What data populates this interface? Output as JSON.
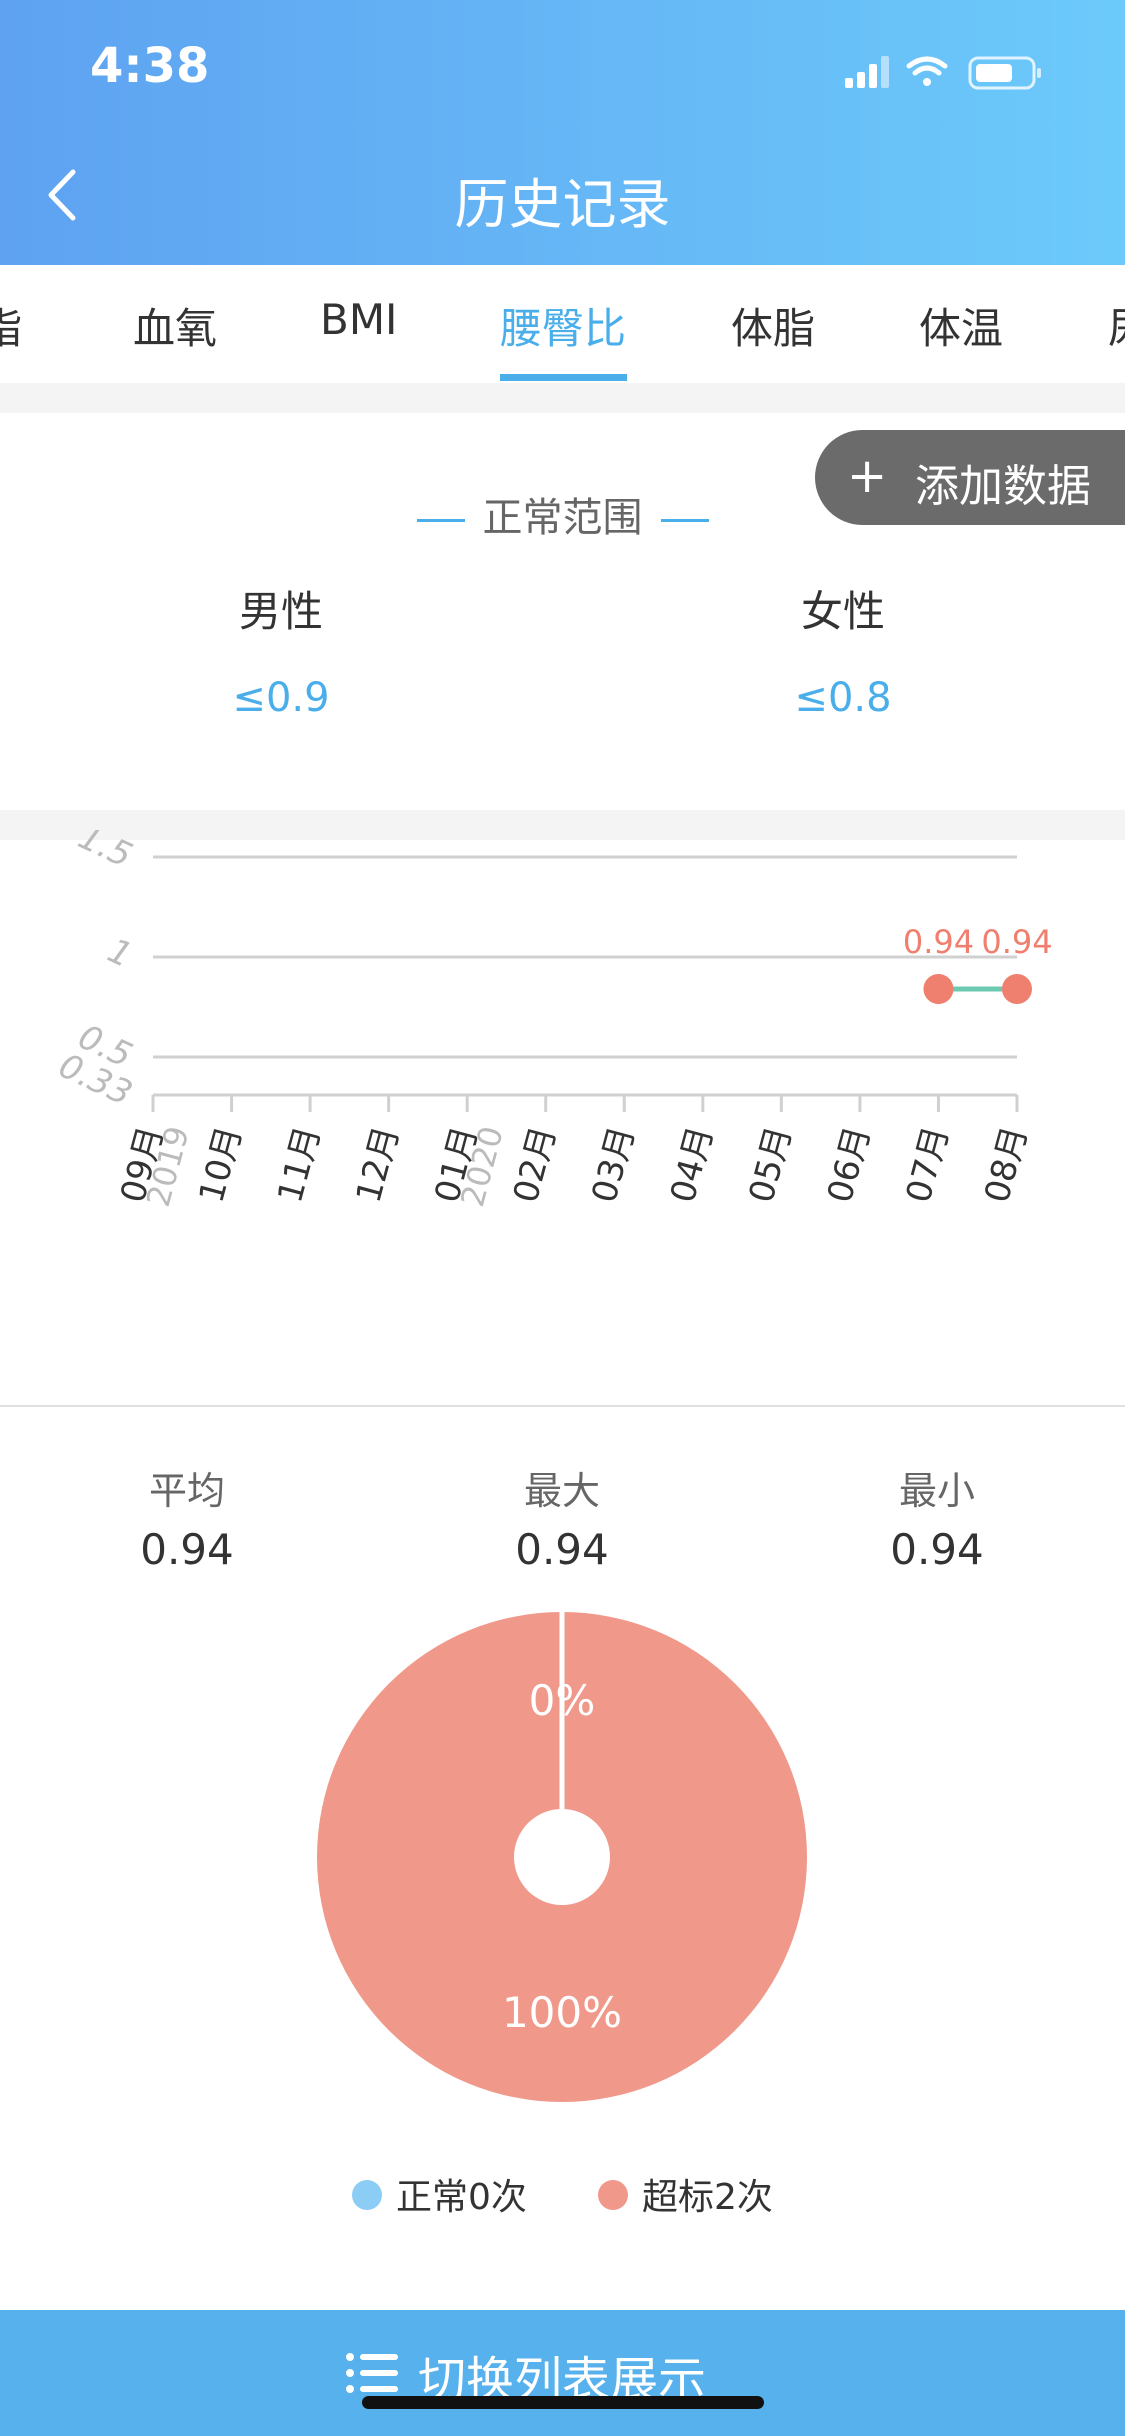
{
  "status": {
    "time": "4:38"
  },
  "header": {
    "title": "历史记录"
  },
  "tabs": [
    {
      "label": "脂"
    },
    {
      "label": "血氧"
    },
    {
      "label": "BMI"
    },
    {
      "label": "腰臀比",
      "active": true
    },
    {
      "label": "体脂"
    },
    {
      "label": "体温"
    },
    {
      "label": "尿"
    }
  ],
  "add_button": {
    "plus": "+",
    "label": "添加数据"
  },
  "normal_range": {
    "title": "正常范围",
    "male_label": "男性",
    "male_value": "≤0.9",
    "female_label": "女性",
    "female_value": "≤0.8"
  },
  "chart_data": {
    "type": "line",
    "y_ticks": [
      "1.5",
      "1",
      "0.5",
      "0.33"
    ],
    "ylim": [
      0.33,
      1.5
    ],
    "categories": [
      "09月",
      "10月",
      "11月",
      "12月",
      "01月",
      "02月",
      "03月",
      "04月",
      "05月",
      "06月",
      "07月",
      "08月"
    ],
    "year_labels": [
      {
        "after_index": 0,
        "text": "2019"
      },
      {
        "after_index": 4,
        "text": "2020"
      }
    ],
    "series": [
      {
        "points": [
          {
            "category": "07月",
            "value": 0.94
          },
          {
            "category": "08月",
            "value": 0.94
          }
        ]
      }
    ],
    "data_labels": [
      "0.94",
      "0.94"
    ],
    "colors": {
      "line": "#6ccab0",
      "point": "#ef7f6e",
      "label": "#ef7f6e",
      "grid": "#d0d0d0",
      "axis_text": "#333333",
      "tick_text": "#bbbbbb"
    }
  },
  "stats": {
    "avg_label": "平均",
    "avg_value": "0.94",
    "max_label": "最大",
    "max_value": "0.94",
    "min_label": "最小",
    "min_value": "0.94"
  },
  "pie": {
    "slices": [
      {
        "label": "0%",
        "value": 0,
        "color": "#8ccdf6"
      },
      {
        "label": "100%",
        "value": 100,
        "color": "#f0998b"
      }
    ]
  },
  "legend": {
    "normal": {
      "label": "正常0次",
      "color": "#8ccdf6"
    },
    "exceed": {
      "label": "超标2次",
      "color": "#f0998b"
    }
  },
  "bottom_bar": {
    "label": "切换列表展示"
  }
}
